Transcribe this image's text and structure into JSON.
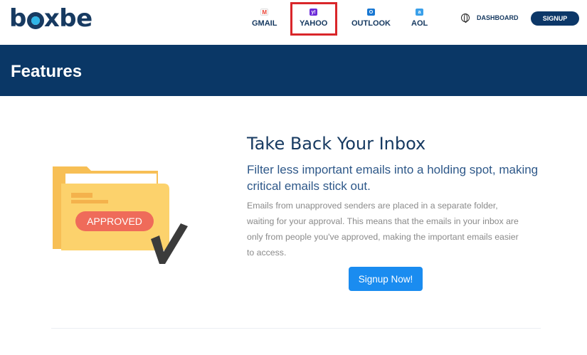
{
  "header": {
    "logo_text": "boxbe",
    "nav": [
      {
        "label": "GMAIL",
        "icon": "gmail-icon"
      },
      {
        "label": "YAHOO",
        "icon": "yahoo-icon"
      },
      {
        "label": "OUTLOOK",
        "icon": "outlook-icon"
      },
      {
        "label": "AOL",
        "icon": "aol-icon"
      }
    ],
    "dashboard_label": "DASHBOARD",
    "signup_label": "SIGNUP"
  },
  "banner": {
    "title": "Features"
  },
  "feature": {
    "illustration_label": "APPROVED",
    "title": "Take Back Your Inbox",
    "subtitle": "Filter less important emails into a holding spot, making critical emails stick out.",
    "body": "Emails from unapproved senders are placed in a separate folder, waiting for your approval. This means that the emails in your inbox are only from people you've approved, making the important emails easier to access.",
    "cta_label": "Signup Now!"
  },
  "colors": {
    "navy": "#0a3766",
    "accent_blue": "#1a8cf0",
    "logo_cyan": "#2fb5e6",
    "highlight_red": "#d9262a",
    "folder_yellow": "#fcd26c",
    "approved_red": "#ef6b5a"
  }
}
